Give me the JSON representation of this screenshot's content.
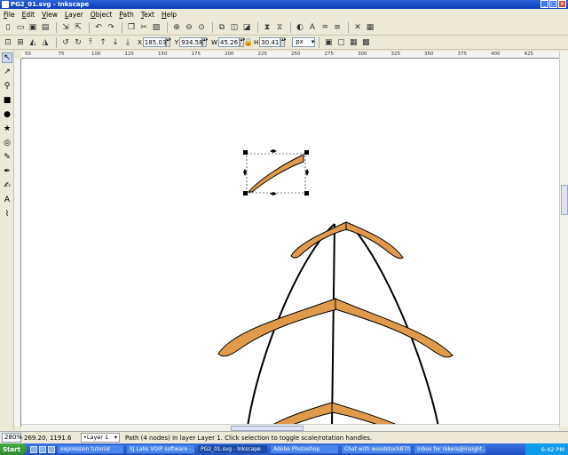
{
  "window": {
    "title": "PG2_01.svg - Inkscape"
  },
  "menu": [
    "File",
    "Edit",
    "View",
    "Layer",
    "Object",
    "Path",
    "Text",
    "Help"
  ],
  "toolbar": {
    "icons": [
      "new-document-icon",
      "open-icon",
      "save-icon",
      "print-icon",
      "sep",
      "import-icon",
      "export-icon",
      "sep",
      "undo-icon",
      "redo-icon",
      "sep",
      "copy-icon",
      "cut-icon",
      "paste-icon",
      "sep",
      "zoom-selection-icon",
      "zoom-drawing-icon",
      "zoom-page-icon",
      "sep",
      "duplicate-icon",
      "clone-icon",
      "unlink-clone-icon",
      "sep",
      "group-icon",
      "ungroup-icon",
      "sep",
      "fill-stroke-icon",
      "text-font-icon",
      "xml-editor-icon",
      "align-icon",
      "sep",
      "preferences-icon",
      "document-properties-icon"
    ]
  },
  "controls": {
    "x_label": "X",
    "x_value": "185.03",
    "y_label": "Y",
    "y_value": "934.58",
    "w_label": "W",
    "w_value": "45.26",
    "h_label": "H",
    "h_value": "30.41",
    "unit": "px"
  },
  "tools": [
    "selector-icon",
    "node-editor-icon",
    "zoom-icon",
    "rectangle-icon",
    "ellipse-icon",
    "star-icon",
    "spiral-icon",
    "pencil-icon",
    "pen-icon",
    "calligraphy-icon",
    "text-icon",
    "dropper-icon"
  ],
  "ruler": {
    "h_labels": [
      "50",
      "75",
      "100",
      "125",
      "150",
      "175",
      "200",
      "225",
      "250",
      "275",
      "300",
      "325",
      "350",
      "375",
      "400",
      "425"
    ]
  },
  "status": {
    "zoom": "280%",
    "coords": "269.20, 1191.6",
    "layer": "•Layer 1",
    "message": "Path (4 nodes) in layer Layer 1. Click selection to toggle scale/rotation handles."
  },
  "taskbar": {
    "start": "Start",
    "tasks": [
      {
        "label": "expression tutorial"
      },
      {
        "label": "SJ Labs VOIP software - ..."
      },
      {
        "label": "PG2_01.svg - Inkscape"
      },
      {
        "label": "Adobe Photoshop"
      },
      {
        "label": "Chat with woodstock870..."
      },
      {
        "label": "Inbox for rekers@insight..."
      }
    ],
    "clock": "6:42 PM"
  },
  "colors": {
    "shape_fill": "#e09a4c",
    "shape_stroke": "#000000",
    "canvas": "#ffffff",
    "title_bar": "#1a4fc8"
  }
}
